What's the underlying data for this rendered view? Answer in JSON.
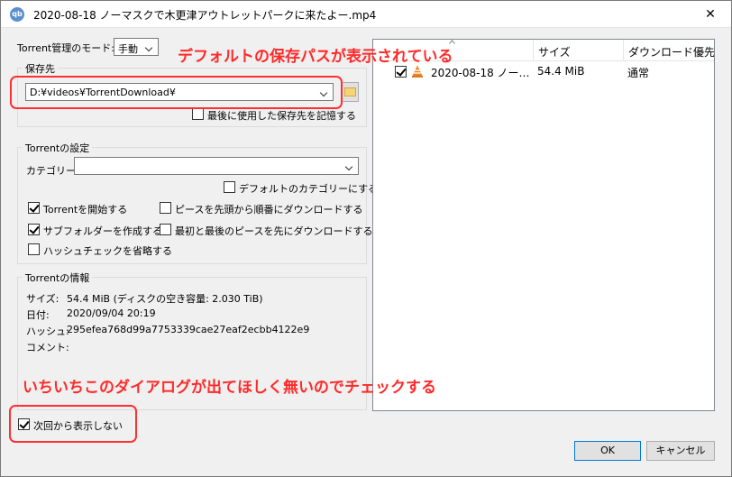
{
  "window": {
    "title": "2020-08-18 ノーマスクで木更津アウトレットパークに来たよー.mp4",
    "app_icon": "qb",
    "close_glyph": "✕"
  },
  "management_mode": {
    "label": "Torrent管理のモード:",
    "value": "手動"
  },
  "save_location": {
    "group_title": "保存先",
    "path": "D:¥videos¥TorrentDownload¥",
    "remember_label": "最後に使用した保存先を記憶する",
    "remember_checked": false
  },
  "torrent_settings": {
    "group_title": "Torrentの設定",
    "category_label": "カテゴリー:",
    "category_value": "",
    "default_category_label": "デフォルトのカテゴリーにする",
    "start_torrent_label": "Torrentを開始する",
    "start_torrent_checked": true,
    "create_subfolder_label": "サブフォルダーを作成する",
    "create_subfolder_checked": true,
    "skip_hash_label": "ハッシュチェックを省略する",
    "skip_hash_checked": false,
    "sequential_label": "ピースを先頭から順番にダウンロードする",
    "sequential_checked": false,
    "first_last_label": "最初と最後のピースを先にダウンロードする",
    "first_last_checked": false
  },
  "torrent_info": {
    "group_title": "Torrentの情報",
    "size_label": "サイズ:",
    "size_value": "54.4 MiB (ディスクの空き容量: 2.030 TiB)",
    "date_label": "日付:",
    "date_value": "2020/09/04 20:19",
    "hash_label": "ハッシュ:",
    "hash_value": "295efea768d99a7753339cae27eaf2ecbb4122e9",
    "comment_label": "コメント:",
    "comment_value": ""
  },
  "dont_show_again": {
    "label": "次回から表示しない",
    "checked": true
  },
  "file_list": {
    "headers": [
      "",
      "サイズ",
      "ダウンロード優先"
    ],
    "rows": [
      {
        "name": "2020-08-18 ノー…",
        "size": "54.4 MiB",
        "priority": "通常",
        "checked": true
      }
    ]
  },
  "buttons": {
    "ok": "OK",
    "cancel": "キャンセル"
  },
  "annotations": {
    "top": "デフォルトの保存パスが表示されている",
    "bottom": "いちいちこのダイアログが出てほしく無いのでチェックする",
    "color": "#ff2a2a"
  }
}
